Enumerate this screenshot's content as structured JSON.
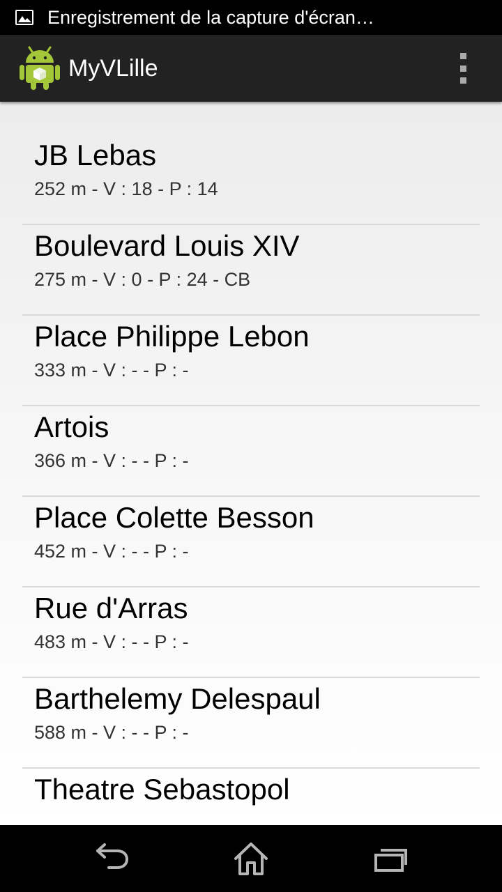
{
  "status_bar": {
    "notification_icon": "image-icon",
    "text": "Enregistrement de la capture d'écran…"
  },
  "action_bar": {
    "app_icon": "android-icon",
    "title": "MyVLille",
    "overflow_icon": "overflow-menu-icon"
  },
  "stations": [
    {
      "name": "JB Lebas",
      "info": "252 m - V : 18 - P : 14"
    },
    {
      "name": "Boulevard Louis XIV",
      "info": "275 m - V : 0 - P : 24 - CB"
    },
    {
      "name": "Place Philippe Lebon",
      "info": "333 m - V : - - P : -"
    },
    {
      "name": "Artois",
      "info": "366 m - V : - - P : -"
    },
    {
      "name": "Place Colette Besson",
      "info": "452 m - V : - - P : -"
    },
    {
      "name": "Rue d'Arras",
      "info": "483 m - V : - - P : -"
    },
    {
      "name": "Barthelemy Delespaul",
      "info": "588 m - V : - - P : -"
    },
    {
      "name": "Theatre Sebastopol",
      "info": ""
    }
  ],
  "nav_bar": {
    "back_icon": "back-icon",
    "home_icon": "home-icon",
    "recents_icon": "recent-apps-icon"
  },
  "colors": {
    "action_bar": "#222222",
    "android_green": "#a4c639",
    "nav_icon": "#b5b5b5"
  }
}
